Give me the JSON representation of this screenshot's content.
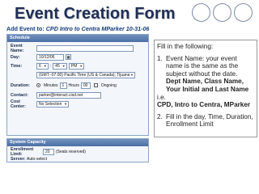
{
  "slide": {
    "title": "Event Creation Form",
    "decor": "three-circles"
  },
  "form": {
    "add_event_prefix": "Add Event to:",
    "add_event_name": "CPD Intro to Centra MParker 10-31-06",
    "schedule_section": "Schedule",
    "event_name_label": "Event Name:",
    "event_name_value": "",
    "date_label": "Day:",
    "date_value": "10/12/06",
    "time_label": "Time:",
    "time_hour": "6",
    "time_minute": "45",
    "time_ampm": "PM",
    "timezone_value": "(GMT -07:00) Pacific Time (US & Canada); Tijuana",
    "duration_label": "Duration:",
    "duration_option": "Minutes",
    "duration_hours_label": "Hours",
    "duration_hours": "1",
    "duration_minutes": "00",
    "ongoing_label": "Ongoing",
    "contact_label": "Contact:",
    "contact_value": "parker@interact.cisd.net",
    "cost_center_label": "Cost Center:",
    "cost_center_value": "No Selection",
    "capacity_section": "System Capacity",
    "enrollment_limit_label": "Enrollment Limit:",
    "enrollment_limit_value": "20",
    "enrollment_limit_note": "(Seats reserved)",
    "server_label": "Server:",
    "server_value": "Auto-select"
  },
  "instructions": {
    "intro": "Fill in the following:",
    "items": [
      {
        "num": "1.",
        "text": "Event Name: your event name is the same as the subject without the date.",
        "bold": "Dept Name, Class Name, Your Initial and Last Name",
        "ie": "i.e.",
        "example": "CPD, Intro to Centra, MParker"
      },
      {
        "num": "2.",
        "text": "Fill in the day, Time, Duration, Enrollment Limit"
      }
    ]
  }
}
